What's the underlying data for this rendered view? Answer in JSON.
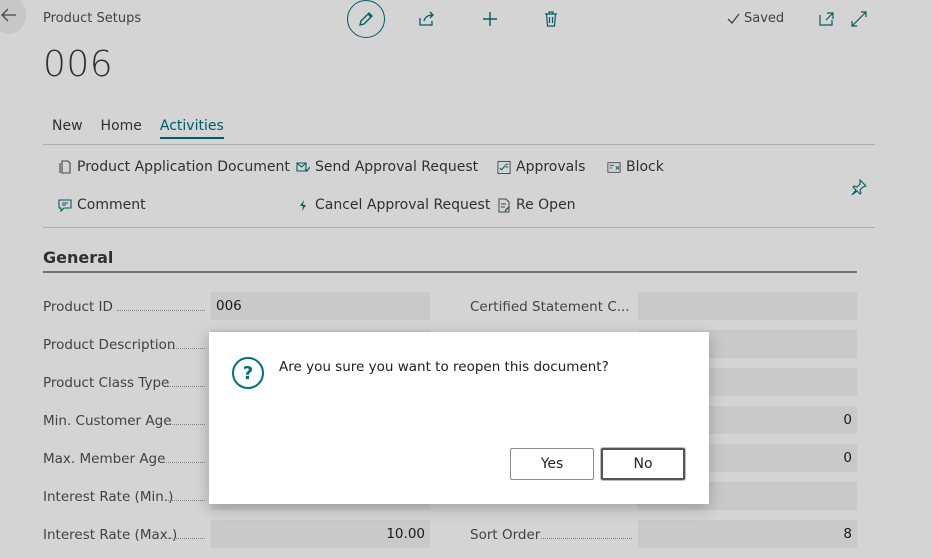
{
  "header": {
    "breadcrumb": "Product Setups",
    "saved_label": "Saved",
    "record_title": "006"
  },
  "tabs": [
    {
      "label": "New"
    },
    {
      "label": "Home"
    },
    {
      "label": "Activities"
    }
  ],
  "actions": {
    "product_application_document": "Product Application Document",
    "send_approval_request": "Send Approval Request",
    "approvals": "Approvals",
    "block": "Block",
    "comment": "Comment",
    "cancel_approval_request": "Cancel Approval Request",
    "re_open": "Re Open"
  },
  "section": {
    "title": "General"
  },
  "fields": {
    "product_id": {
      "label": "Product ID",
      "value": "006"
    },
    "product_description": {
      "label": "Product Description"
    },
    "product_class_type": {
      "label": "Product Class Type"
    },
    "min_customer_age": {
      "label": "Min. Customer Age"
    },
    "max_member_age": {
      "label": "Max. Member Age"
    },
    "interest_rate_min": {
      "label": "Interest Rate (Min.)"
    },
    "interest_rate_max": {
      "label": "Interest Rate (Max.)",
      "value": "10.00"
    },
    "certified_statement": {
      "label": "Certified Statement C..."
    },
    "right_row4_value": "0",
    "right_row5_value": "0",
    "sort_order": {
      "label": "Sort Order",
      "value": "8"
    }
  },
  "dialog": {
    "message": "Are you sure you want to reopen this document?",
    "yes_label": "Yes",
    "no_label": "No"
  },
  "colors": {
    "accent": "#00707a"
  }
}
